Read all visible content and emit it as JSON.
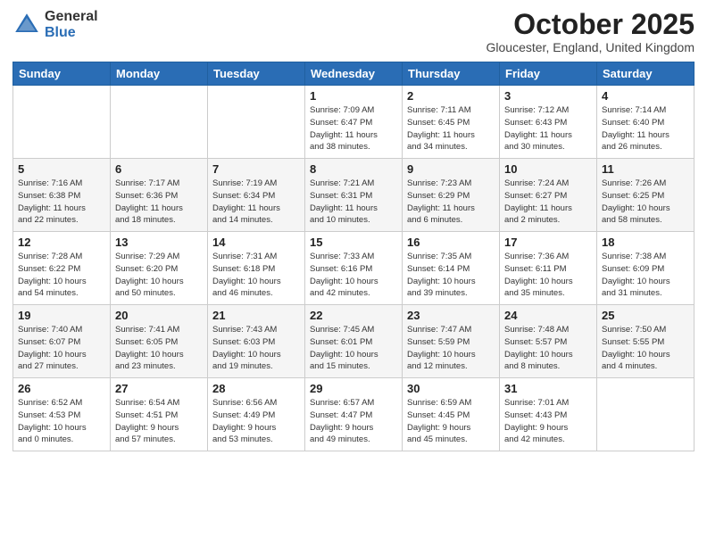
{
  "logo": {
    "general": "General",
    "blue": "Blue"
  },
  "header": {
    "month": "October 2025",
    "location": "Gloucester, England, United Kingdom"
  },
  "days_of_week": [
    "Sunday",
    "Monday",
    "Tuesday",
    "Wednesday",
    "Thursday",
    "Friday",
    "Saturday"
  ],
  "weeks": [
    [
      {
        "day": "",
        "info": ""
      },
      {
        "day": "",
        "info": ""
      },
      {
        "day": "",
        "info": ""
      },
      {
        "day": "1",
        "info": "Sunrise: 7:09 AM\nSunset: 6:47 PM\nDaylight: 11 hours\nand 38 minutes."
      },
      {
        "day": "2",
        "info": "Sunrise: 7:11 AM\nSunset: 6:45 PM\nDaylight: 11 hours\nand 34 minutes."
      },
      {
        "day": "3",
        "info": "Sunrise: 7:12 AM\nSunset: 6:43 PM\nDaylight: 11 hours\nand 30 minutes."
      },
      {
        "day": "4",
        "info": "Sunrise: 7:14 AM\nSunset: 6:40 PM\nDaylight: 11 hours\nand 26 minutes."
      }
    ],
    [
      {
        "day": "5",
        "info": "Sunrise: 7:16 AM\nSunset: 6:38 PM\nDaylight: 11 hours\nand 22 minutes."
      },
      {
        "day": "6",
        "info": "Sunrise: 7:17 AM\nSunset: 6:36 PM\nDaylight: 11 hours\nand 18 minutes."
      },
      {
        "day": "7",
        "info": "Sunrise: 7:19 AM\nSunset: 6:34 PM\nDaylight: 11 hours\nand 14 minutes."
      },
      {
        "day": "8",
        "info": "Sunrise: 7:21 AM\nSunset: 6:31 PM\nDaylight: 11 hours\nand 10 minutes."
      },
      {
        "day": "9",
        "info": "Sunrise: 7:23 AM\nSunset: 6:29 PM\nDaylight: 11 hours\nand 6 minutes."
      },
      {
        "day": "10",
        "info": "Sunrise: 7:24 AM\nSunset: 6:27 PM\nDaylight: 11 hours\nand 2 minutes."
      },
      {
        "day": "11",
        "info": "Sunrise: 7:26 AM\nSunset: 6:25 PM\nDaylight: 10 hours\nand 58 minutes."
      }
    ],
    [
      {
        "day": "12",
        "info": "Sunrise: 7:28 AM\nSunset: 6:22 PM\nDaylight: 10 hours\nand 54 minutes."
      },
      {
        "day": "13",
        "info": "Sunrise: 7:29 AM\nSunset: 6:20 PM\nDaylight: 10 hours\nand 50 minutes."
      },
      {
        "day": "14",
        "info": "Sunrise: 7:31 AM\nSunset: 6:18 PM\nDaylight: 10 hours\nand 46 minutes."
      },
      {
        "day": "15",
        "info": "Sunrise: 7:33 AM\nSunset: 6:16 PM\nDaylight: 10 hours\nand 42 minutes."
      },
      {
        "day": "16",
        "info": "Sunrise: 7:35 AM\nSunset: 6:14 PM\nDaylight: 10 hours\nand 39 minutes."
      },
      {
        "day": "17",
        "info": "Sunrise: 7:36 AM\nSunset: 6:11 PM\nDaylight: 10 hours\nand 35 minutes."
      },
      {
        "day": "18",
        "info": "Sunrise: 7:38 AM\nSunset: 6:09 PM\nDaylight: 10 hours\nand 31 minutes."
      }
    ],
    [
      {
        "day": "19",
        "info": "Sunrise: 7:40 AM\nSunset: 6:07 PM\nDaylight: 10 hours\nand 27 minutes."
      },
      {
        "day": "20",
        "info": "Sunrise: 7:41 AM\nSunset: 6:05 PM\nDaylight: 10 hours\nand 23 minutes."
      },
      {
        "day": "21",
        "info": "Sunrise: 7:43 AM\nSunset: 6:03 PM\nDaylight: 10 hours\nand 19 minutes."
      },
      {
        "day": "22",
        "info": "Sunrise: 7:45 AM\nSunset: 6:01 PM\nDaylight: 10 hours\nand 15 minutes."
      },
      {
        "day": "23",
        "info": "Sunrise: 7:47 AM\nSunset: 5:59 PM\nDaylight: 10 hours\nand 12 minutes."
      },
      {
        "day": "24",
        "info": "Sunrise: 7:48 AM\nSunset: 5:57 PM\nDaylight: 10 hours\nand 8 minutes."
      },
      {
        "day": "25",
        "info": "Sunrise: 7:50 AM\nSunset: 5:55 PM\nDaylight: 10 hours\nand 4 minutes."
      }
    ],
    [
      {
        "day": "26",
        "info": "Sunrise: 6:52 AM\nSunset: 4:53 PM\nDaylight: 10 hours\nand 0 minutes."
      },
      {
        "day": "27",
        "info": "Sunrise: 6:54 AM\nSunset: 4:51 PM\nDaylight: 9 hours\nand 57 minutes."
      },
      {
        "day": "28",
        "info": "Sunrise: 6:56 AM\nSunset: 4:49 PM\nDaylight: 9 hours\nand 53 minutes."
      },
      {
        "day": "29",
        "info": "Sunrise: 6:57 AM\nSunset: 4:47 PM\nDaylight: 9 hours\nand 49 minutes."
      },
      {
        "day": "30",
        "info": "Sunrise: 6:59 AM\nSunset: 4:45 PM\nDaylight: 9 hours\nand 45 minutes."
      },
      {
        "day": "31",
        "info": "Sunrise: 7:01 AM\nSunset: 4:43 PM\nDaylight: 9 hours\nand 42 minutes."
      },
      {
        "day": "",
        "info": ""
      }
    ]
  ]
}
